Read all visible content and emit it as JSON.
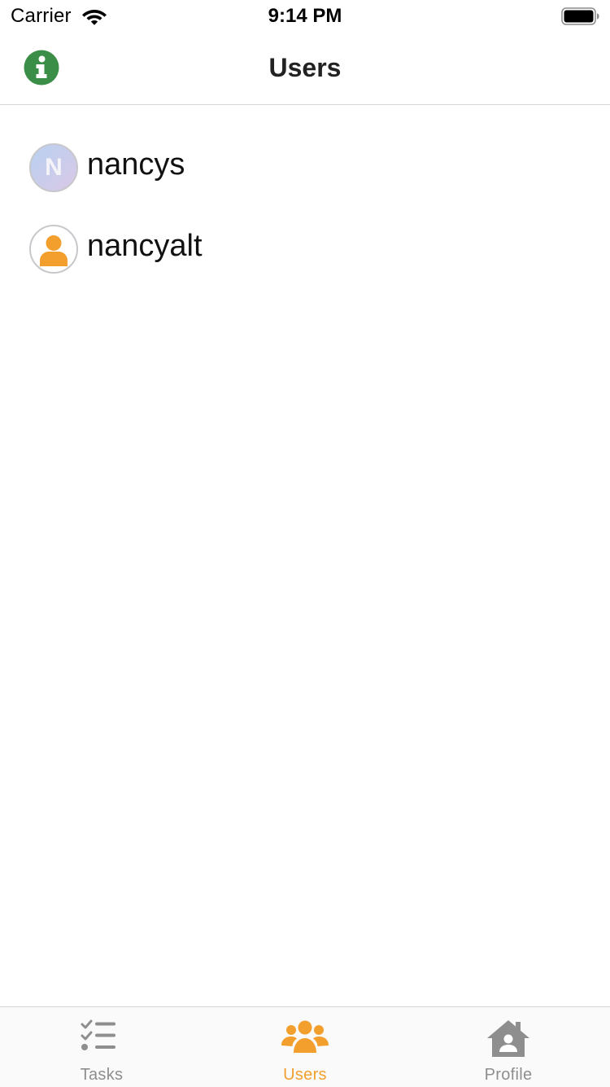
{
  "status_bar": {
    "carrier": "Carrier",
    "time": "9:14 PM"
  },
  "nav": {
    "title": "Users",
    "info_icon": "info-icon"
  },
  "users": [
    {
      "name": "nancys",
      "avatar": "initial",
      "initial": "N"
    },
    {
      "name": "nancyalt",
      "avatar": "default-person"
    }
  ],
  "tabs": [
    {
      "label": "Tasks",
      "icon": "checklist-icon",
      "selected": false
    },
    {
      "label": "Users",
      "icon": "users-group-icon",
      "selected": true
    },
    {
      "label": "Profile",
      "icon": "home-person-icon",
      "selected": false
    }
  ],
  "colors": {
    "accent": "#F29F2E",
    "info_green": "#3A8E47",
    "tab_inactive": "#8E8E8E",
    "separator": "#D6D6D8"
  }
}
